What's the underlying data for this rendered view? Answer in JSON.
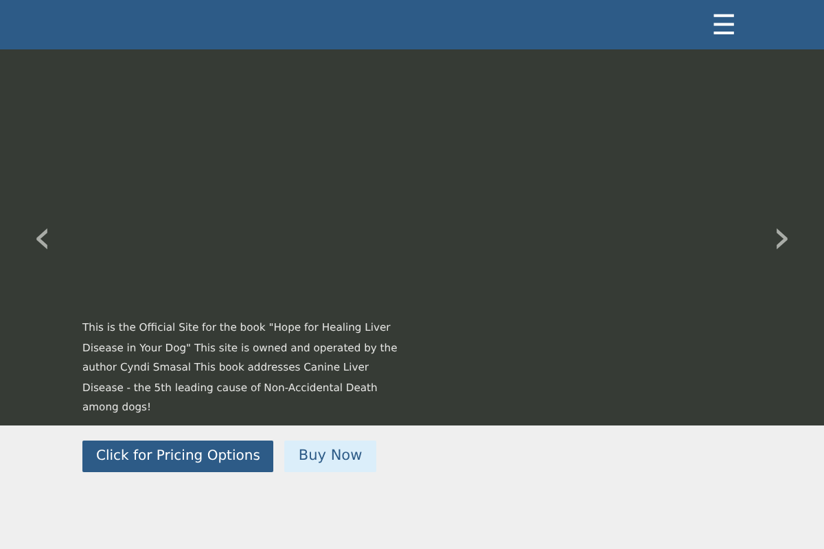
{
  "navbar": {
    "menu_icon": "☰"
  },
  "carousel": {
    "prev": "‹",
    "next": "›",
    "caption": "This is the Official Site for the book \"Hope for Healing Liver Disease in Your Dog\" This site is owned and operated by the author Cyndi Smasal This book addresses Canine Liver Disease -  the 5th leading cause of Non-Accidental Death among dogs!",
    "buttons": [
      {
        "label": "Click for Pricing Options",
        "kind": "primary"
      },
      {
        "label": "Buy Now",
        "kind": "light"
      }
    ]
  }
}
